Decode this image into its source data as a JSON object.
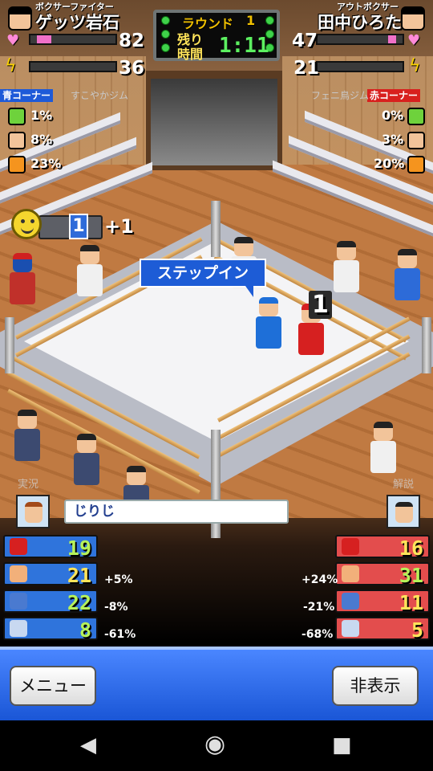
{
  "left_fighter": {
    "title": "ボクサーファイター",
    "name": "ゲッツ岩石",
    "hp": "82",
    "stamina": "36",
    "corner": "青コーナー",
    "gym": "すこやかジム",
    "stats": {
      "speaker": "1%",
      "people": "8%",
      "fire": "23%"
    },
    "panels": [
      {
        "icon": "glove-icon",
        "value": "19",
        "pct": ""
      },
      {
        "icon": "muscle-icon",
        "value": "21",
        "pct": "+5%"
      },
      {
        "icon": "defense-icon",
        "value": "22",
        "pct": "-8%"
      },
      {
        "icon": "shoe-icon",
        "value": "8",
        "pct": "-61%"
      }
    ]
  },
  "right_fighter": {
    "title": "アウトボクサー",
    "name": "田中ひろた",
    "hp": "47",
    "stamina": "21",
    "corner": "赤コーナー",
    "gym": "フェニ鳥ジム",
    "stats": {
      "speaker": "0%",
      "people": "3%",
      "fire": "20%"
    },
    "panels": [
      {
        "icon": "glove-icon",
        "value": "16",
        "pct": ""
      },
      {
        "icon": "muscle-icon",
        "value": "31",
        "pct": "+24%"
      },
      {
        "icon": "defense-icon",
        "value": "11",
        "pct": "-21%"
      },
      {
        "icon": "shoe-icon",
        "value": "5",
        "pct": "-68%"
      }
    ]
  },
  "round": {
    "label": "ラウンド",
    "number": "1",
    "remaining_label_1": "残り",
    "remaining_label_2": "時間",
    "time": "1:11"
  },
  "momentum": {
    "combo": "1",
    "bonus": "+1"
  },
  "action_text": "ステップイン",
  "count_badge": "1",
  "commentary": {
    "left_label": "実況",
    "right_label": "解説",
    "text": "じりじ"
  },
  "buttons": {
    "menu": "メニュー",
    "hide": "非表示"
  },
  "colors": {
    "blue_corner": "#2f74dc",
    "red_corner": "#e34d4d",
    "hp_bar": "#f070c8"
  }
}
